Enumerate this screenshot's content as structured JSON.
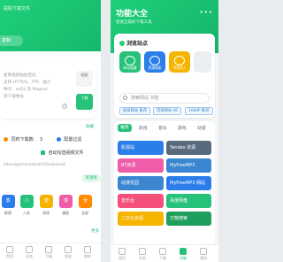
{
  "left": {
    "header_text": "提取下载文件",
    "pill_text": "复制",
    "input_hint_lines": [
      "复制链接粘贴至此",
      "支持 HTTP/S、FTP、磁力",
      "种子、ed2k 及 Magnet",
      "等下载地址"
    ],
    "paste_label": "粘贴",
    "download_label": "下载",
    "collect_label": "收藏",
    "timing_label": "同时下载数:",
    "timing_value": "3",
    "config_label": "配置过滤",
    "auto_label": "自动勾选视频文件",
    "path_text": "/storage/emulated/0/Download",
    "tag_text": "资源库",
    "tiles": [
      {
        "glyph": "影",
        "label": "影视",
        "color": "#2b7de9"
      },
      {
        "glyph": "八",
        "label": "八卦",
        "color": "#27c27a"
      },
      {
        "glyph": "游",
        "label": "游戏",
        "color": "#f5b400"
      },
      {
        "glyph": "漫",
        "label": "漫画",
        "color": "#ef5da8"
      },
      {
        "glyph": "全",
        "label": "全部",
        "color": "#ff8a00"
      }
    ],
    "more_label": "更多",
    "nav": [
      "首页",
      "任务",
      "下载",
      "发现",
      "我的"
    ]
  },
  "right": {
    "title": "功能大全",
    "subtitle": "极速全能的下载工具",
    "menu_dots": "•••",
    "card_title": "浏览站点",
    "apps": [
      {
        "label": "网站收藏",
        "color": "#27c27a"
      },
      {
        "label": "资源搜索",
        "color": "#2b7de9"
      },
      {
        "label": "书签导入",
        "color": "#f5b400"
      }
    ],
    "search_placeholder": "搜索网站 书签",
    "chips": [
      "磁链网站 推荐",
      "资源网站 46",
      "1080P 推荐"
    ],
    "tabs": [
      "推荐",
      "影视",
      "音乐",
      "游戏",
      "动漫"
    ],
    "rows_left": [
      {
        "label": "影视站",
        "color": "#2b7de9"
      },
      {
        "label": "BT资源",
        "color": "#ef5da8"
      },
      {
        "label": "动漫花园",
        "color": "#3a86d1"
      },
      {
        "label": "音乐台",
        "color": "#f4507a"
      },
      {
        "label": "二次元资源",
        "color": "#f5b400"
      }
    ],
    "rows_right": [
      {
        "label": "Yandex 资源",
        "color": "#586a7e"
      },
      {
        "label": "MyFreeMP3",
        "color": "#3a86d1"
      },
      {
        "label": "MyFreeMP3 网站",
        "color": "#2b7de9"
      },
      {
        "label": "百度网盘",
        "color": "#27c27a"
      },
      {
        "label": "万物搜索",
        "color": "#1f9f5d"
      }
    ],
    "nav": [
      "首页",
      "任务",
      "下载",
      "功能",
      "我的"
    ]
  }
}
